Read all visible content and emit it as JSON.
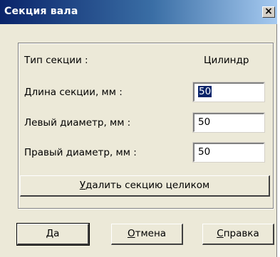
{
  "window": {
    "title": "Секция вала",
    "close_glyph": "×"
  },
  "section_type": {
    "label": "Тип секции :",
    "value": "Цилиндр"
  },
  "fields": {
    "length": {
      "label": "Длина секции, мм :",
      "value": "50"
    },
    "left_diameter": {
      "label": "Левый диаметр, мм :",
      "value": "50"
    },
    "right_diameter": {
      "label": "Правый диаметр, мм :",
      "value": "50"
    }
  },
  "buttons": {
    "delete": {
      "mnemonic": "У",
      "rest": "далить секцию целиком"
    },
    "ok": {
      "mnemonic": "Д",
      "rest": "а"
    },
    "cancel": {
      "mnemonic": "О",
      "rest": "тмена"
    },
    "help": {
      "mnemonic": "С",
      "rest": "правка"
    }
  },
  "colors": {
    "title_start": "#0a246a",
    "title_end": "#a6caf0",
    "dialog_bg": "#ece9d8"
  }
}
